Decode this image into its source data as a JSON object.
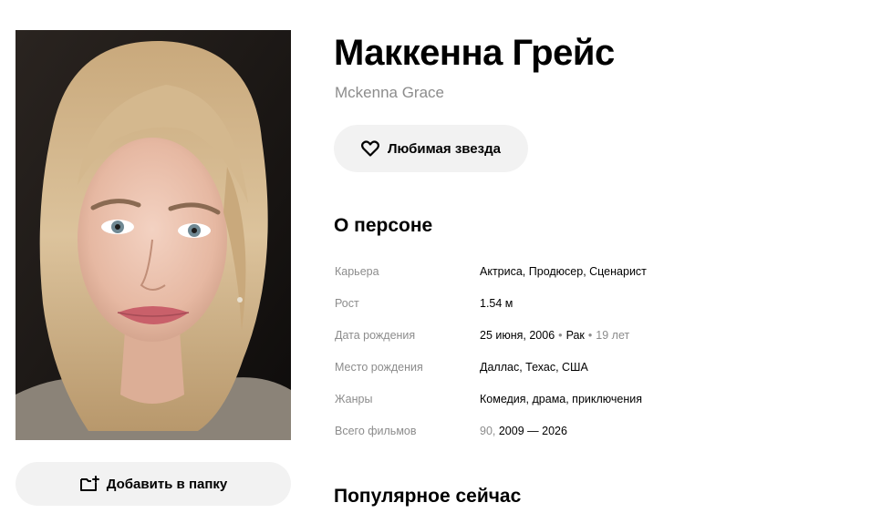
{
  "person": {
    "name_ru": "Маккенна Грейс",
    "name_original": "Mckenna Grace"
  },
  "photo": {
    "icon": "portrait-photo"
  },
  "actions": {
    "favorite_label": "Любимая звезда",
    "favorite_icon": "heart-icon",
    "add_to_folder_label": "Добавить в папку",
    "add_to_folder_icon": "folder-add-icon"
  },
  "about": {
    "title": "О персоне",
    "rows": [
      {
        "label": "Карьера",
        "value": "Актриса, Продюсер, Сценарист"
      },
      {
        "label": "Рост",
        "value": "1.54 м"
      },
      {
        "label": "Дата рождения",
        "date": "25 июня, 2006",
        "sign": "Рак",
        "age": "19 лет"
      },
      {
        "label": "Место рождения",
        "value": "Даллас, Техас, США"
      },
      {
        "label": "Жанры",
        "value": "Комедия, драма, приключения"
      },
      {
        "label": "Всего фильмов",
        "count": "90",
        "years": "2009 — 2026"
      }
    ]
  },
  "popular": {
    "title": "Популярное сейчас"
  },
  "colors": {
    "muted_text": "#8c8c8c",
    "button_bg": "#f2f2f2"
  }
}
